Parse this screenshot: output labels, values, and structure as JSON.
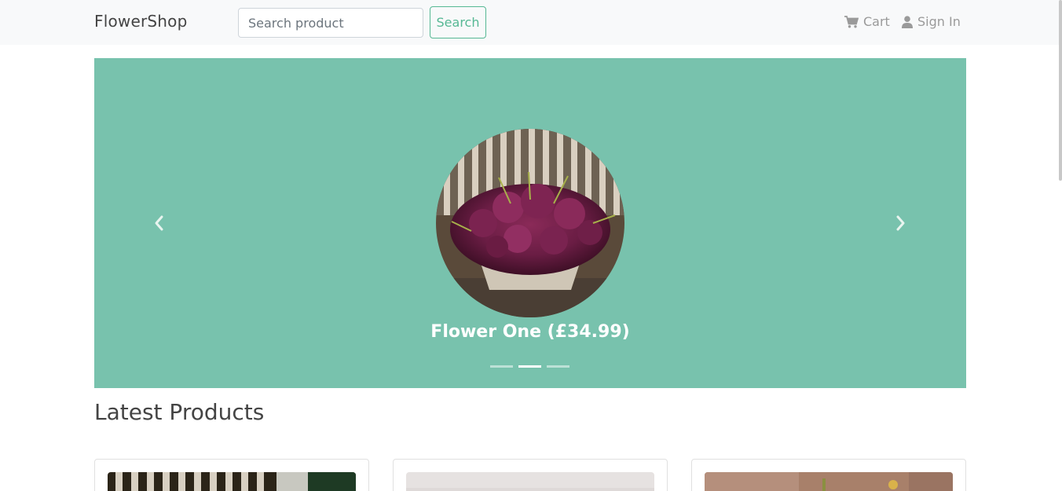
{
  "navbar": {
    "brand": "FlowerShop",
    "search_placeholder": "Search product",
    "search_label": "Search",
    "cart_label": "Cart",
    "signin_label": "Sign In"
  },
  "carousel": {
    "caption": "Flower One (£34.99)",
    "indicators": 3,
    "active_index": 1,
    "prev_icon": "chevron-left-icon",
    "next_icon": "chevron-right-icon",
    "background": "#78c2ad"
  },
  "latest": {
    "title": "Latest Products"
  },
  "colors": {
    "accent": "#56b894",
    "navbar_bg": "#f8f9fa"
  }
}
